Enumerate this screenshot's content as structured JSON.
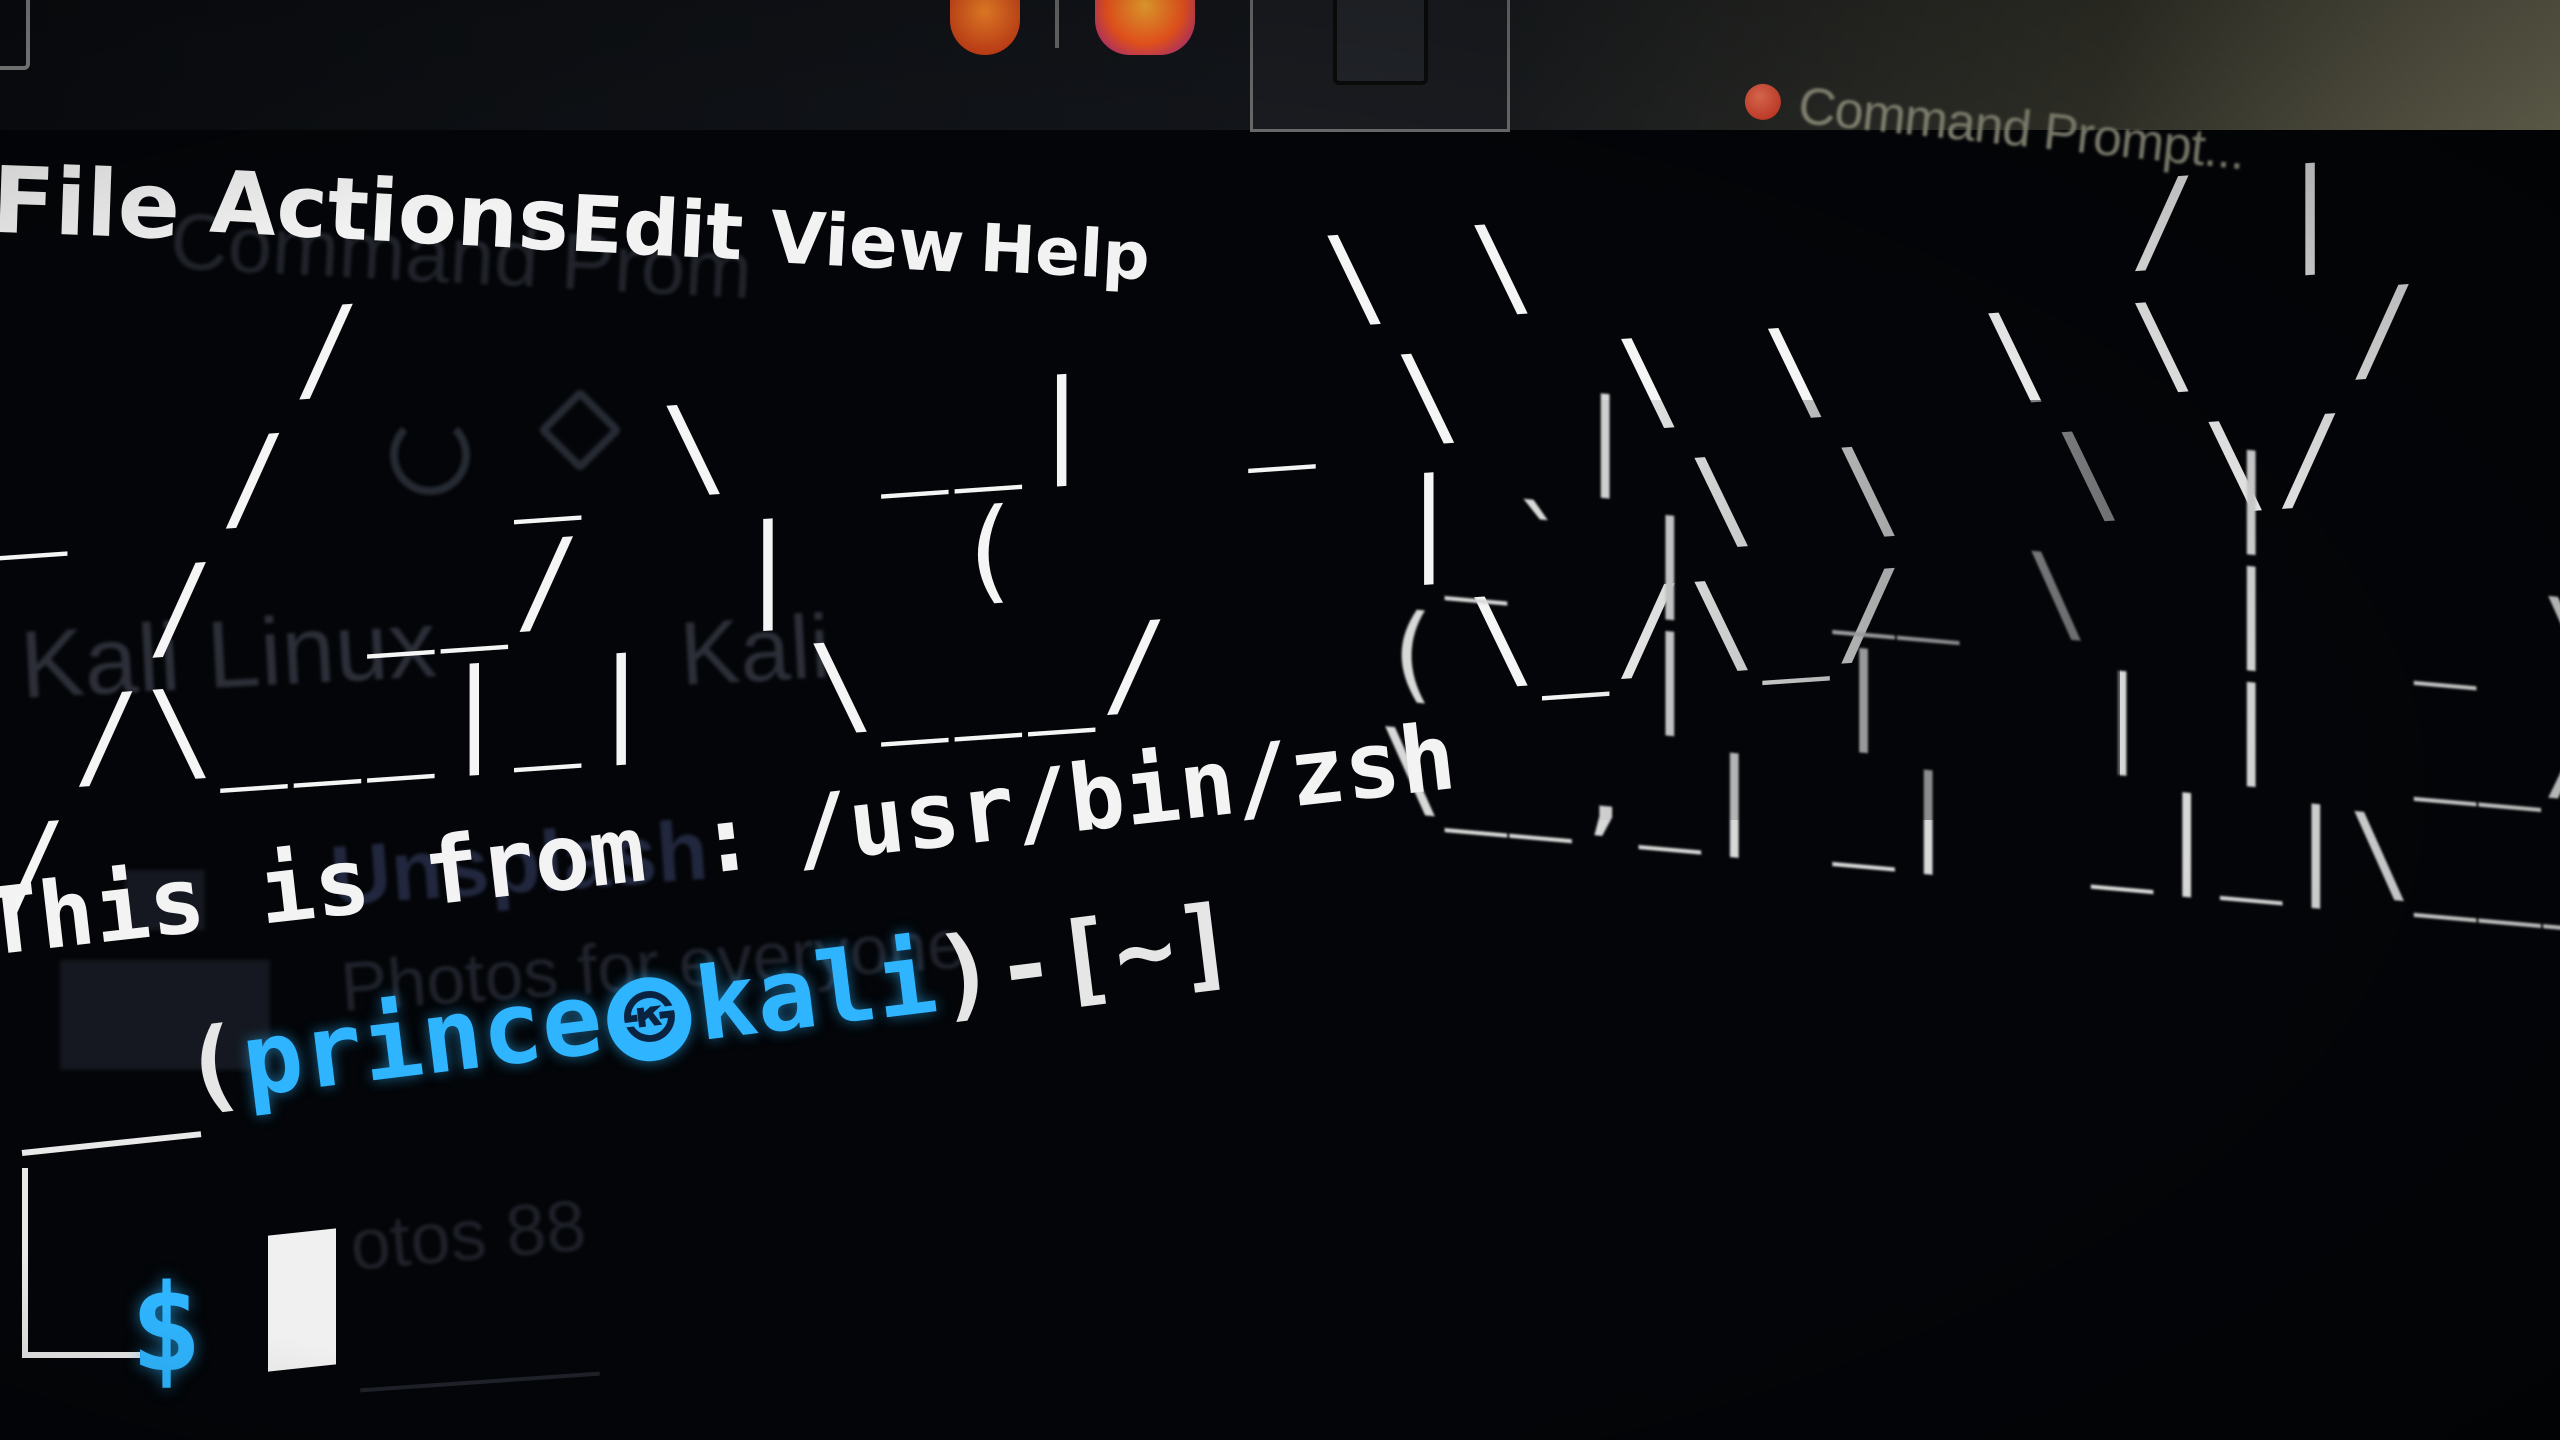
{
  "taskbar": {
    "active_task_label": "Command Prompt...",
    "icons": [
      "app-red-icon",
      "firefox-icon",
      "terminal-icon"
    ]
  },
  "menubar": {
    "items": [
      "File",
      "Actions",
      "Edit",
      "View",
      "Help"
    ]
  },
  "background_window": {
    "lines": [
      "Command Prom",
      "Kali Linux",
      "Kali",
      "Unsplash",
      "Photos for everyone",
      "otos 88"
    ]
  },
  "banner": {
    "main": "    /             \\ \\        / |\n_  /   _ \\  __|  _ \\  \\ \\  \\ \\  /\n  /  __/  |  (     |   \\ \\  \\ \\/\n /\\___|_|  \\___/    \\_/\\_/\n/",
    "right": "   |         |\n _` |  __ \\  |  _ \\\n(   |  |   | |  __/\n\\__,_| _|  _|_|\\___|"
  },
  "terminal": {
    "info_label": "This is from :",
    "shell_path": "/usr/bin/zsh",
    "prompt_open": "(",
    "user": "prince",
    "at_symbol": "㉿",
    "host": "kali",
    "prompt_close": ")-[",
    "cwd": "~",
    "prompt_end": "]",
    "symbol": "$"
  },
  "colors": {
    "prompt_accent": "#2fb5ff",
    "text": "#f3f3f3",
    "background": "#030508"
  }
}
